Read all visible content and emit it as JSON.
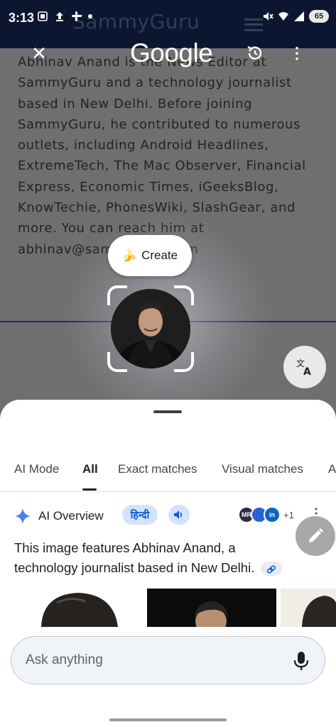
{
  "status_bar": {
    "time": "3:13",
    "battery": "65"
  },
  "background_page": {
    "site_name": "SammyGuru",
    "article_lines": [
      "Abhinav Anand is the News Editor at",
      "SammyGuru and a technology journalist",
      "based in New Delhi. Before joining",
      "SammyGuru, he contributed to numerous",
      "outlets, including Android Headlines,",
      "ExtremeTech, The Mac Observer, Financial",
      "Express, Economic Times, iGeeksBlog,",
      "KnowTechie, PhonesWiki, SlashGear, and",
      "more. You can reach him at",
      "abhinav@sammyguru.com"
    ]
  },
  "lens_bar": {
    "logo": "Google",
    "close_icon": "close-icon",
    "history_icon": "history-icon",
    "more_icon": "more-vert-icon"
  },
  "selection": {
    "create_label": "Create",
    "create_icon": "banana"
  },
  "sheet": {
    "tabs": [
      {
        "label": "AI Mode"
      },
      {
        "label": "All"
      },
      {
        "label": "Exact matches"
      },
      {
        "label": "Visual matches"
      },
      {
        "label": "A"
      }
    ],
    "active_tab": "All",
    "ai_overview": {
      "title": "AI Overview",
      "language_chip": "हिन्दी",
      "source_badges": [
        "MR",
        "",
        "in"
      ],
      "source_more": "+1",
      "text": "This image features Abhinav Anand, a technology journalist based in New Delhi."
    },
    "ask": {
      "placeholder": "Ask anything"
    }
  },
  "colors": {
    "accent_blue": "#0b57d0",
    "chip_bg": "#d3e3fd",
    "sheet_bg": "#ffffff",
    "header_navy": "#0d1631"
  }
}
